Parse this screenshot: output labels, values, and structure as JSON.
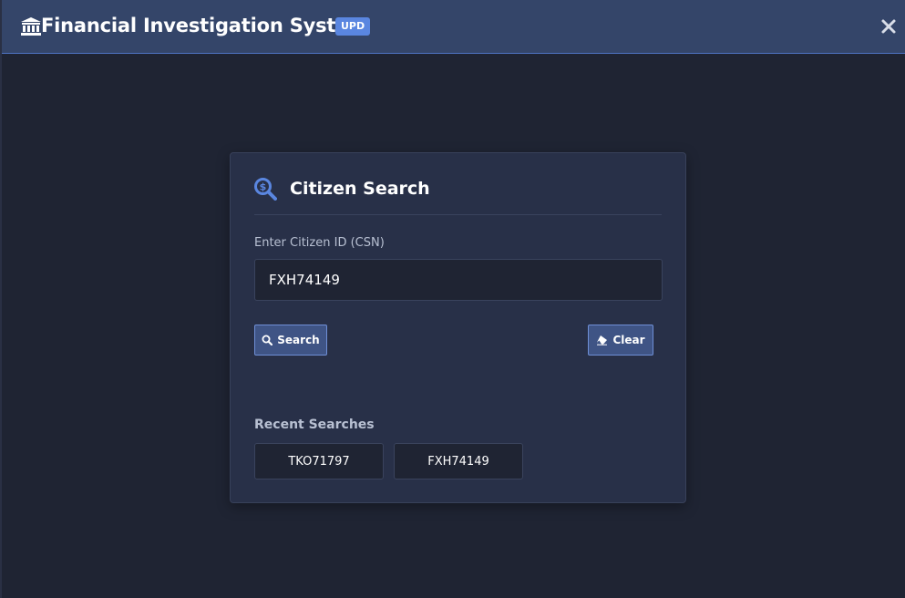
{
  "header": {
    "title": "Financial Investigation System",
    "badge": "UPD",
    "icon": "bank-icon",
    "close_icon": "close-icon"
  },
  "search_panel": {
    "icon": "search-dollar-icon",
    "title": "Citizen Search",
    "field_label": "Enter Citizen ID (CSN)",
    "input_value": "FXH74149",
    "search_button": "Search",
    "clear_button": "Clear"
  },
  "recent": {
    "label": "Recent Searches",
    "items": [
      "TKO71797",
      "FXH74149"
    ]
  },
  "colors": {
    "background": "#1f2433",
    "titlebar": "#344569",
    "panel": "#283048",
    "accent": "#5a86e0",
    "button": "#3f5485"
  }
}
